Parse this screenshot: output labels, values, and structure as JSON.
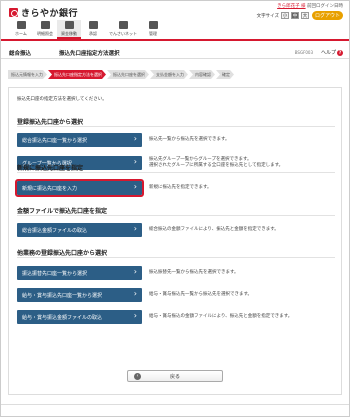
{
  "header": {
    "bank_name": "きらやか銀行",
    "user_name": "きら郎花子 様",
    "last_login": "前回ログイン日時",
    "font_size_label": "文字サイズ",
    "font_sizes": [
      "小",
      "中",
      "大"
    ],
    "logout_label": "ログアウト"
  },
  "gnav": [
    {
      "label": "ホーム"
    },
    {
      "label": "明細照会"
    },
    {
      "label": "資金移動"
    },
    {
      "label": "承認"
    },
    {
      "label": "でんさいネット"
    },
    {
      "label": "管理"
    }
  ],
  "page": {
    "category": "総合振込",
    "title": "振込先口座指定方法選択",
    "screen_code": "BSGF003",
    "help_label": "ヘルプ"
  },
  "steps": [
    {
      "label": "振込元情報を入力",
      "active": false
    },
    {
      "label": "振込先口座指定方法を選択",
      "active": true
    },
    {
      "label": "振込先口座を選択",
      "active": false
    },
    {
      "label": "支払金額を入力",
      "active": false
    },
    {
      "label": "内容確認",
      "active": false
    },
    {
      "label": "確定",
      "active": false
    }
  ],
  "intro": "振込先口座の指定方法を選択してください。",
  "sections": [
    {
      "heading": "登録振込先口座から選択",
      "items": [
        {
          "button": "総合振込先口座一覧から選択",
          "desc": [
            "振込先一覧から振込先を選択できます。"
          ]
        },
        {
          "button": "グループ一覧から選択",
          "desc": [
            "振込先グループ一覧からグループを選択できます。",
            "選択されたグループに所属する全口座を振込先として指定します。"
          ]
        }
      ]
    },
    {
      "heading": "新規に振込先口座を指定",
      "items": [
        {
          "button": "新規に振込先口座を入力",
          "desc": [
            "新規に振込先を指定できます。"
          ],
          "selected": true
        }
      ]
    },
    {
      "heading": "金額ファイルで振込先口座を指定",
      "items": [
        {
          "button": "総合振込金額ファイルの取込",
          "desc": [
            "総合振込の金額ファイルにより、振込先と金額を指定できます。"
          ]
        }
      ]
    },
    {
      "heading": "他業務の登録振込先口座から選択",
      "items": [
        {
          "button": "振込振替先口座一覧から選択",
          "desc": [
            "振込振替先一覧から振込先を選択できます。"
          ]
        },
        {
          "button": "給与・賞与振込先口座一覧から選択",
          "desc": [
            "給与・賞与振込先一覧から振込先を選択できます。"
          ]
        },
        {
          "button": "給与・賞与振込金額ファイルの取込",
          "desc": [
            "給与・賞与振込の金額ファイルにより、振込先と金額を指定できます。"
          ]
        }
      ]
    }
  ],
  "back_label": "戻る",
  "colors": {
    "brand_red": "#d6182f",
    "button_blue": "#2c5e86",
    "logout_orange": "#e8a000"
  }
}
